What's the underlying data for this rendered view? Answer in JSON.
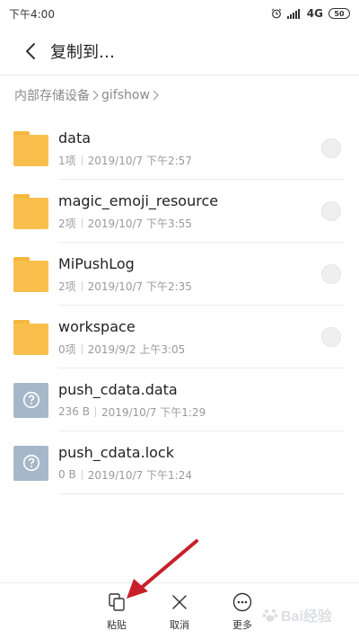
{
  "status_bar": {
    "time": "下午4:00",
    "network": "4G",
    "battery": "50"
  },
  "header": {
    "title": "复制到…"
  },
  "breadcrumb": {
    "root": "内部存储设备",
    "current": "gifshow"
  },
  "files": [
    {
      "name": "data",
      "items": "1项",
      "date": "2019/10/7 下午2:57",
      "type": "folder"
    },
    {
      "name": "magic_emoji_resource",
      "items": "2项",
      "date": "2019/10/7 下午3:55",
      "type": "folder"
    },
    {
      "name": "MiPushLog",
      "items": "2项",
      "date": "2019/10/7 下午2:35",
      "type": "folder"
    },
    {
      "name": "workspace",
      "items": "0项",
      "date": "2019/9/2 上午3:05",
      "type": "folder"
    },
    {
      "name": "push_cdata.data",
      "items": "236 B",
      "date": "2019/10/7 下午1:29",
      "type": "unknown"
    },
    {
      "name": "push_cdata.lock",
      "items": "0 B",
      "date": "2019/10/7 下午1:24",
      "type": "unknown"
    }
  ],
  "toolbar": {
    "paste_label": "粘贴",
    "cancel_label": "取消",
    "more_label": "更多"
  },
  "watermark": {
    "text": "Bai经验"
  },
  "colors": {
    "folder": "#f9bf4c",
    "unknown_file": "#a6b7c9",
    "arrow": "#c8202a"
  }
}
